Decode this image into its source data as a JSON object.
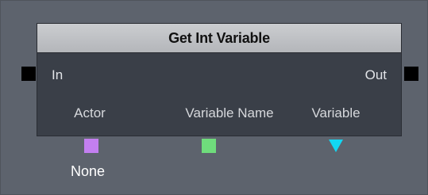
{
  "node": {
    "title": "Get Int Variable",
    "inputs": {
      "in_label": "In"
    },
    "outputs": {
      "out_label": "Out"
    },
    "variable_links": [
      {
        "label": "Actor",
        "color": "#c37ff0",
        "shape": "square",
        "value": "None"
      },
      {
        "label": "Variable Name",
        "color": "#6fdc7c",
        "shape": "square"
      },
      {
        "label": "Variable",
        "color": "#12d7f3",
        "shape": "triangle"
      }
    ]
  },
  "colors": {
    "canvas_bg": "#5d636d",
    "node_body": "#3a3f48",
    "node_header": "#c0c2c6",
    "io_port": "#000000"
  }
}
